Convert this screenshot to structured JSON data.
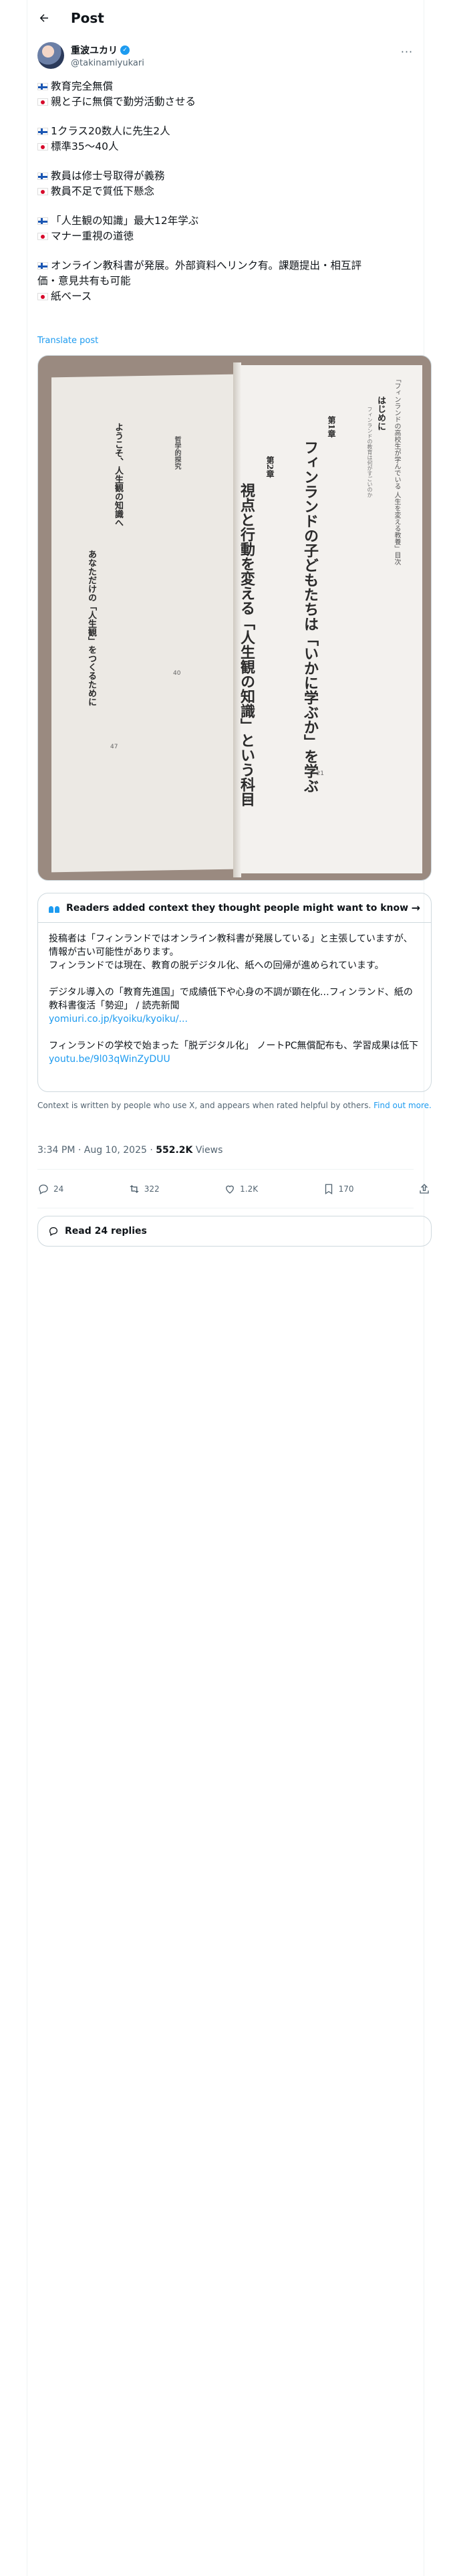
{
  "header": {
    "title": "Post"
  },
  "author": {
    "name": "重波ユカリ",
    "handle": "@takinamiyukari"
  },
  "post": {
    "lines": [
      {
        "flag": "fi",
        "text": "教育完全無償"
      },
      {
        "flag": "jp",
        "text": "親と子に無償で勤労活動させる"
      },
      {
        "flag": "fi",
        "text": "1クラス20数人に先生2人"
      },
      {
        "flag": "jp",
        "text": "標準35〜40人"
      },
      {
        "flag": "fi",
        "text": "教員は修士号取得が義務"
      },
      {
        "flag": "jp",
        "text": "教員不足で質低下懸念"
      },
      {
        "flag": "fi",
        "text": "「人生観の知識」最大12年学ぶ"
      },
      {
        "flag": "jp",
        "text": "マナー重視の道徳"
      },
      {
        "flag": "fi",
        "text": "オンライン教科書が発展。外部資料へリンク有。課題提出・相互評"
      },
      {
        "flag": "",
        "text": "価・意見共有も可能"
      },
      {
        "flag": "jp",
        "text": "紙ベース"
      }
    ],
    "translate_label": "Translate post"
  },
  "book": {
    "right_header": "「フィンランドの高校生が学んでいる 人生を変える教養」目次",
    "hajimeni": "はじめに",
    "hajimeni_body": "フィンランドの教育は何がすごいのか",
    "chapter1_label": "第1章",
    "chapter1_title": "フィンランドの子どもたちは「いかに学ぶか」を学ぶ",
    "chapter2_label": "第2章",
    "chapter2_title": "視点と行動を変える「人生観の知識」という科目",
    "left_col1": "ようこそ、人生観の知識へ",
    "left_col2": "あなただけの「人生観」をつくるために",
    "left_col3": "哲学的探究",
    "page_21": "21",
    "page_39": "39",
    "page_40": "40",
    "page_47": "47"
  },
  "note": {
    "header": "Readers added context they thought people might want to know",
    "p1": "投稿者は「フィンランドではオンライン教科書が発展している」と主張していますが、情報が古い可能性があります。",
    "p2": "フィンランドでは現在、教育の脱デジタル化、紙への回帰が進められています。",
    "p3": "デジタル導入の「教育先進国」で成績低下や心身の不調が顕在化…フィンランド、紙の教科書復活「勢迎」 / 読売新聞",
    "link1": "yomiuri.co.jp/kyoiku/kyoiku/...",
    "p4": "フィンランドの学校で始まった「脱デジタル化」 ノートPC無償配布も、学習成果は低下",
    "link2": "youtu.be/9l03qWinZyDUU"
  },
  "context_line": {
    "text": "Context is written by people who use X, and appears when rated helpful by others.",
    "link": "Find out more."
  },
  "meta": {
    "time": "3:34 PM · Aug 10, 2025 · ",
    "views_count": "552.2K",
    "views_label": " Views"
  },
  "actions": {
    "replies": "24",
    "reposts": "322",
    "likes": "1.2K",
    "bookmarks": "170"
  },
  "read_replies": "Read 24 replies"
}
